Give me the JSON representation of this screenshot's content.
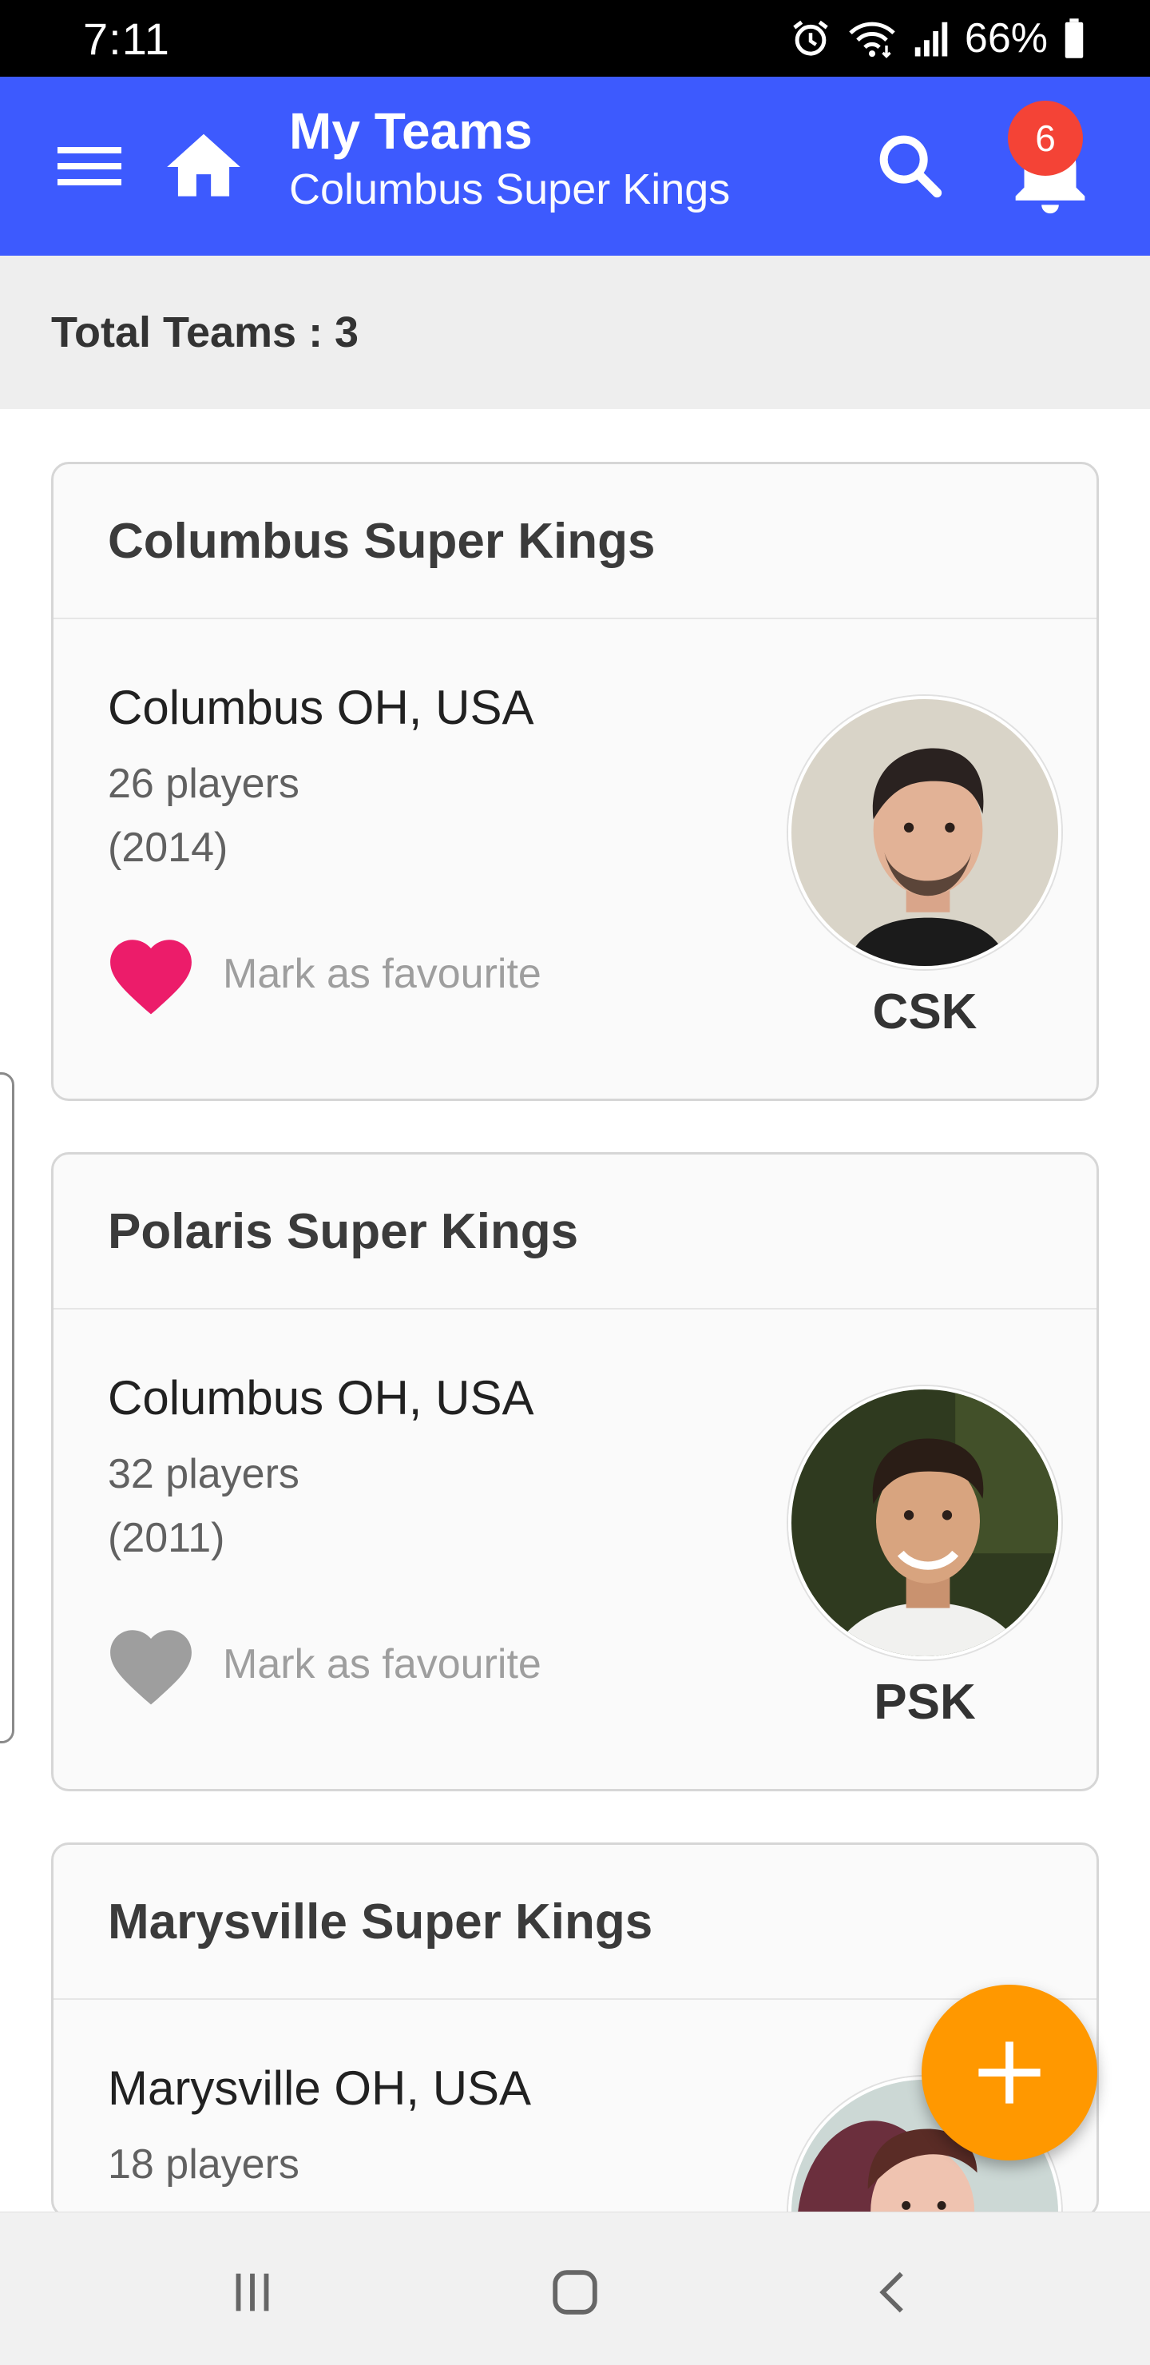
{
  "status_bar": {
    "time": "7:11",
    "battery": "66%",
    "icons": [
      "alarm-icon",
      "wifi-icon",
      "signal-icon",
      "battery-icon"
    ]
  },
  "app_bar": {
    "title": "My Teams",
    "subtitle": "Columbus Super Kings",
    "notification_count": "6",
    "icons": [
      "menu-icon",
      "home-icon",
      "search-icon",
      "bell-icon"
    ],
    "color": "#3d5afe"
  },
  "summary": {
    "total_label": "Total Teams : 3"
  },
  "teams": [
    {
      "name": "Columbus Super Kings",
      "location": "Columbus OH, USA",
      "players": "26 players",
      "year": "(2014)",
      "favourite_label": "Mark as favourite",
      "favourite": true,
      "abbr": "CSK"
    },
    {
      "name": "Polaris Super Kings",
      "location": "Columbus OH, USA",
      "players": "32 players",
      "year": "(2011)",
      "favourite_label": "Mark as favourite",
      "favourite": false,
      "abbr": "PSK"
    },
    {
      "name": "Marysville Super Kings",
      "location": "Marysville OH, USA",
      "players": "18 players",
      "year": "",
      "favourite_label": "",
      "favourite": false,
      "abbr": ""
    }
  ],
  "colors": {
    "favourite_active": "#ec1c6a",
    "favourite_inactive": "#9e9e9e",
    "fab": "#ff9800",
    "badge": "#f44336"
  },
  "fab": {
    "icon": "plus-icon"
  },
  "nav_bar": {
    "icons": [
      "recents-icon",
      "home-nav-icon",
      "back-icon"
    ]
  }
}
